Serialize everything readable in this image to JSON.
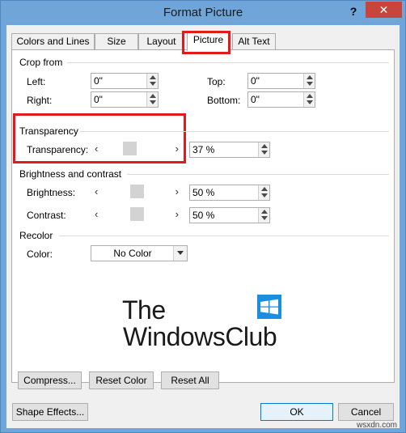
{
  "window": {
    "title": "Format Picture",
    "help": "?",
    "close": "✕"
  },
  "tabs": [
    {
      "label": "Colors and Lines"
    },
    {
      "label": "Size"
    },
    {
      "label": "Layout"
    },
    {
      "label": "Picture",
      "active": true
    },
    {
      "label": "Alt Text"
    }
  ],
  "crop": {
    "heading": "Crop from",
    "left": {
      "label": "Left:",
      "value": "0\""
    },
    "right": {
      "label": "Right:",
      "value": "0\""
    },
    "top": {
      "label": "Top:",
      "value": "0\""
    },
    "bottom": {
      "label": "Bottom:",
      "value": "0\""
    }
  },
  "transparency": {
    "heading": "Transparency",
    "label": "Transparency:",
    "value": "37 %",
    "slider_level": 0.37
  },
  "brightness_contrast": {
    "heading": "Brightness and contrast",
    "brightness": {
      "label": "Brightness:",
      "value": "50 %",
      "slider_level": 0.5
    },
    "contrast": {
      "label": "Contrast:",
      "value": "50 %",
      "slider_level": 0.5
    }
  },
  "recolor": {
    "heading": "Recolor",
    "color_label": "Color:",
    "color_value": "No Color"
  },
  "logo": {
    "line1": "The",
    "line2": "WindowsClub"
  },
  "buttons": {
    "compress": "Compress...",
    "reset_color": "Reset Color",
    "reset_all": "Reset All",
    "shape_effects": "Shape Effects...",
    "ok": "OK",
    "cancel": "Cancel"
  },
  "watermark": "wsxdn.com",
  "colors": {
    "accent": "#0078d7",
    "highlight": "#e11b1b",
    "close": "#c7453c",
    "frame": "#6fa5d8"
  }
}
